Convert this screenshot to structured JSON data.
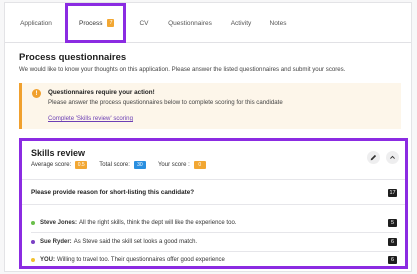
{
  "tabs": [
    {
      "label": "Application"
    },
    {
      "label": "Process",
      "badge": "7"
    },
    {
      "label": "CV"
    },
    {
      "label": "Questionnaires"
    },
    {
      "label": "Activity"
    },
    {
      "label": "Notes"
    }
  ],
  "page": {
    "title": "Process questionnaires",
    "subtitle": "We would like to know your thoughts on this application. Please answer the listed questionnaires and submit your scores."
  },
  "warning": {
    "icon": "alert-icon",
    "title": "Questionnaires require your action!",
    "text": "Please answer the process questionnaires below to complete scoring for this candidate",
    "link": "Complete 'Skills review' scoring"
  },
  "skills_review": {
    "title": "Skills review",
    "average_label": "Average score:",
    "average_value": "0.5",
    "total_label": "Total score:",
    "total_value": "30",
    "your_label": "Your score :",
    "your_value": "0",
    "question": "Please provide reason for short-listing this candidate?",
    "question_count": "17",
    "comments": [
      {
        "author": "Steve Jones:",
        "text": "All the right skills, think the dept will like the experience too.",
        "count": "5",
        "dot_color": "#6abf4b"
      },
      {
        "author": "Sue Ryder:",
        "text": "As Steve said the skill set looks a good match.",
        "count": "6",
        "dot_color": "#7b3fc4"
      },
      {
        "author": "YOU:",
        "text": "Willing to travel too. Their questionnaires offer good experience",
        "count": "6",
        "dot_color": "#f2c12e"
      }
    ]
  },
  "colors": {
    "accent": "#8b2be2",
    "warning": "#f0a02e",
    "link": "#6c3fb5"
  }
}
